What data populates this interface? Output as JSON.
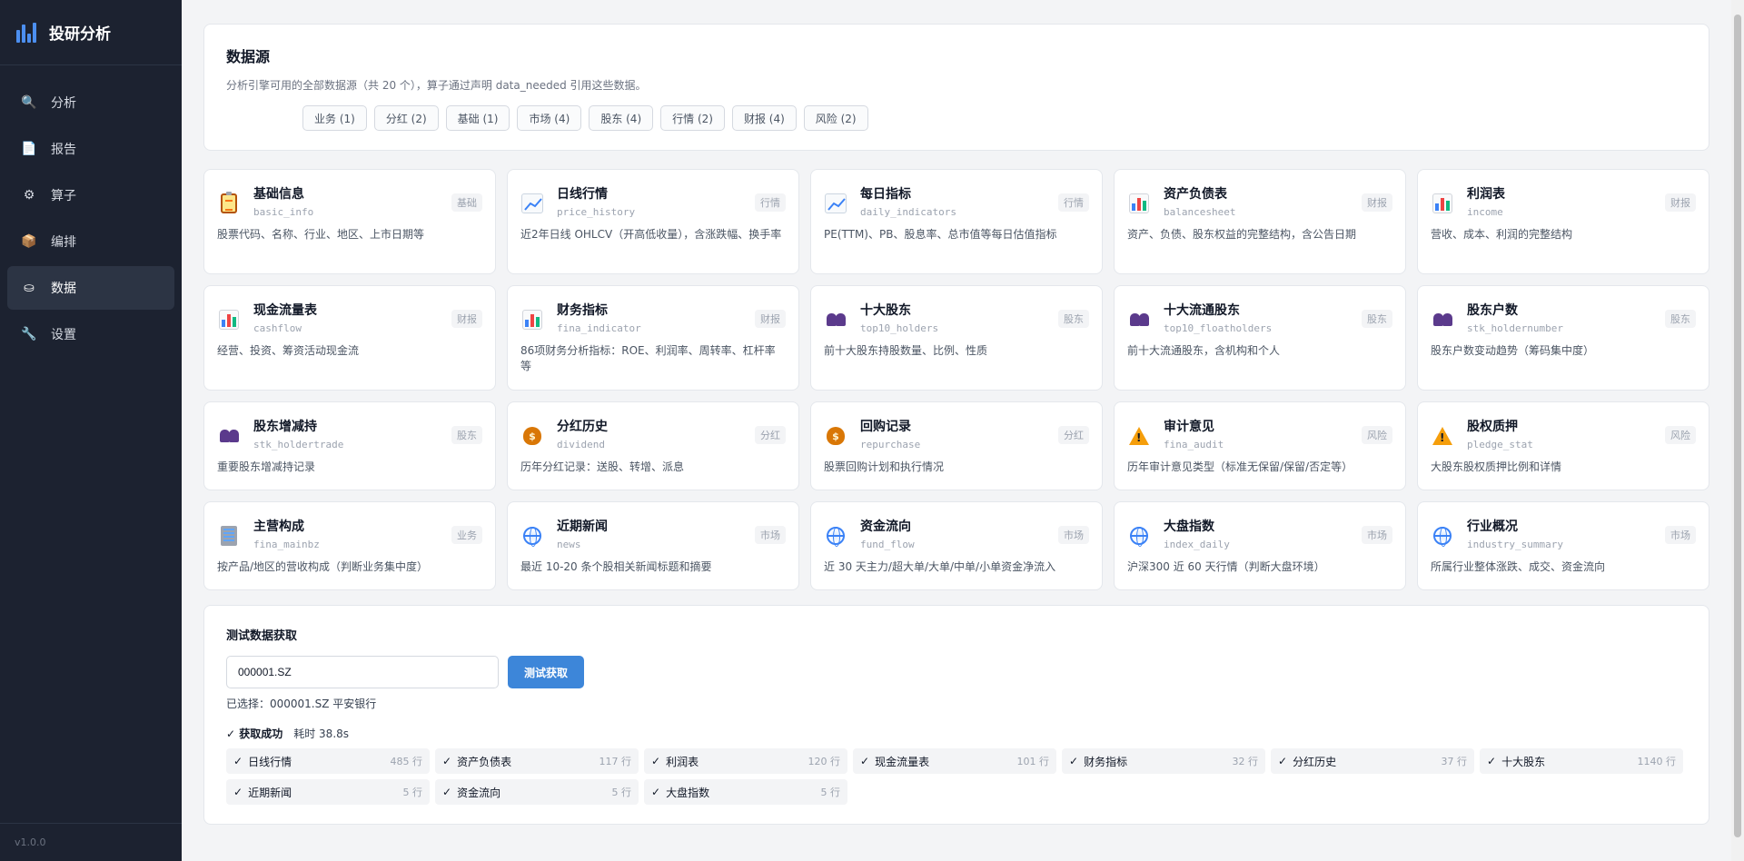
{
  "brand": {
    "title": "投研分析"
  },
  "nav": [
    {
      "label": "分析",
      "icon": "magnifier-icon"
    },
    {
      "label": "报告",
      "icon": "document-icon"
    },
    {
      "label": "算子",
      "icon": "gear-icon"
    },
    {
      "label": "编排",
      "icon": "package-icon"
    },
    {
      "label": "数据",
      "icon": "database-icon"
    },
    {
      "label": "设置",
      "icon": "wrench-icon"
    }
  ],
  "nav_active": "数据",
  "version": "v1.0.0",
  "datasource": {
    "title": "数据源",
    "description": "分析引擎可用的全部数据源（共 20 个），算子通过声明 data_needed 引用这些数据。",
    "filters": [
      "业务 (1)",
      "分红 (2)",
      "基础 (1)",
      "市场 (4)",
      "股东 (4)",
      "行情 (2)",
      "财报 (4)",
      "风险 (2)"
    ]
  },
  "sources": [
    {
      "name": "基础信息",
      "code": "basic_info",
      "tag": "基础",
      "desc": "股票代码、名称、行业、地区、上市日期等",
      "icon": "clipboard-icon"
    },
    {
      "name": "日线行情",
      "code": "price_history",
      "tag": "行情",
      "desc": "近2年日线 OHLCV（开高低收量），含涨跌幅、换手率",
      "icon": "trend-chart-icon"
    },
    {
      "name": "每日指标",
      "code": "daily_indicators",
      "tag": "行情",
      "desc": "PE(TTM)、PB、股息率、总市值等每日估值指标",
      "icon": "trend-chart-icon"
    },
    {
      "name": "资产负债表",
      "code": "balancesheet",
      "tag": "财报",
      "desc": "资产、负债、股东权益的完整结构，含公告日期",
      "icon": "bar-chart-icon"
    },
    {
      "name": "利润表",
      "code": "income",
      "tag": "财报",
      "desc": "营收、成本、利润的完整结构",
      "icon": "bar-chart-icon"
    },
    {
      "name": "现金流量表",
      "code": "cashflow",
      "tag": "财报",
      "desc": "经营、投资、筹资活动现金流",
      "icon": "bar-chart-icon"
    },
    {
      "name": "财务指标",
      "code": "fina_indicator",
      "tag": "财报",
      "desc": "86项财务分析指标：ROE、利润率、周转率、杠杆率等",
      "icon": "bar-chart-icon"
    },
    {
      "name": "十大股东",
      "code": "top10_holders",
      "tag": "股东",
      "desc": "前十大股东持股数量、比例、性质",
      "icon": "people-icon"
    },
    {
      "name": "十大流通股东",
      "code": "top10_floatholders",
      "tag": "股东",
      "desc": "前十大流通股东，含机构和个人",
      "icon": "people-icon"
    },
    {
      "name": "股东户数",
      "code": "stk_holdernumber",
      "tag": "股东",
      "desc": "股东户数变动趋势（筹码集中度）",
      "icon": "people-icon"
    },
    {
      "name": "股东增减持",
      "code": "stk_holdertrade",
      "tag": "股东",
      "desc": "重要股东增减持记录",
      "icon": "people-icon"
    },
    {
      "name": "分红历史",
      "code": "dividend",
      "tag": "分红",
      "desc": "历年分红记录：送股、转增、派息",
      "icon": "money-bag-icon"
    },
    {
      "name": "回购记录",
      "code": "repurchase",
      "tag": "分红",
      "desc": "股票回购计划和执行情况",
      "icon": "money-bag-icon"
    },
    {
      "name": "审计意见",
      "code": "fina_audit",
      "tag": "风险",
      "desc": "历年审计意见类型（标准无保留/保留/否定等）",
      "icon": "warning-icon"
    },
    {
      "name": "股权质押",
      "code": "pledge_stat",
      "tag": "风险",
      "desc": "大股东股权质押比例和详情",
      "icon": "warning-icon"
    },
    {
      "name": "主营构成",
      "code": "fina_mainbz",
      "tag": "业务",
      "desc": "按产品/地区的营收构成（判断业务集中度）",
      "icon": "building-icon"
    },
    {
      "name": "近期新闻",
      "code": "news",
      "tag": "市场",
      "desc": "最近 10-20 条个股相关新闻标题和摘要",
      "icon": "globe-icon"
    },
    {
      "name": "资金流向",
      "code": "fund_flow",
      "tag": "市场",
      "desc": "近 30 天主力/超大单/大单/中单/小单资金净流入",
      "icon": "globe-icon"
    },
    {
      "name": "大盘指数",
      "code": "index_daily",
      "tag": "市场",
      "desc": "沪深300 近 60 天行情（判断大盘环境）",
      "icon": "globe-icon"
    },
    {
      "name": "行业概况",
      "code": "industry_summary",
      "tag": "市场",
      "desc": "所属行业整体涨跌、成交、资金流向",
      "icon": "globe-icon"
    }
  ],
  "test": {
    "title": "测试数据获取",
    "input_value": "000001.SZ",
    "button_label": "测试获取",
    "selected": "已选择：000001.SZ 平安银行",
    "status": "✓ 获取成功",
    "time": "耗时 38.8s",
    "results": [
      {
        "name": "日线行情",
        "count": "485 行"
      },
      {
        "name": "资产负债表",
        "count": "117 行"
      },
      {
        "name": "利润表",
        "count": "120 行"
      },
      {
        "name": "现金流量表",
        "count": "101 行"
      },
      {
        "name": "财务指标",
        "count": "32 行"
      },
      {
        "name": "分红历史",
        "count": "37 行"
      },
      {
        "name": "十大股东",
        "count": "1140 行"
      },
      {
        "name": "近期新闻",
        "count": "5 行"
      },
      {
        "name": "资金流向",
        "count": "5 行"
      },
      {
        "name": "大盘指数",
        "count": "5 行"
      }
    ]
  }
}
